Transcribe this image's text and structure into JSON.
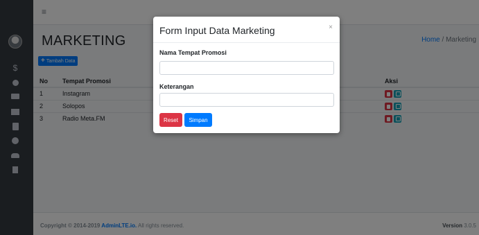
{
  "sidebar": {
    "icons": [
      "avatar",
      "dollar-icon",
      "circle-icon",
      "ticket-icon",
      "building-icon",
      "calculator-icon",
      "info-icon",
      "users-icon",
      "document-icon"
    ],
    "dollar": "$"
  },
  "topbar": {
    "menu_icon": "≡"
  },
  "page": {
    "title": "MARKETING",
    "breadcrumb": {
      "home": "Home",
      "separator": "/",
      "current": "Marketing"
    },
    "add_button": "Tambah Data"
  },
  "table": {
    "headers": {
      "no": "No",
      "name": "Tempat Promosi",
      "action": "Aksi"
    },
    "rows": [
      {
        "no": "1",
        "name": "Instagram"
      },
      {
        "no": "2",
        "name": "Solopos"
      },
      {
        "no": "3",
        "name": "Radio Meta.FM"
      }
    ]
  },
  "footer": {
    "copyright": "Copyright © 2014-2019 ",
    "brand": "AdminLTE.io.",
    "rights": " All rights reserved.",
    "version_label": "Version",
    "version": "3.0.5"
  },
  "modal": {
    "title": "Form Input Data Marketing",
    "close": "×",
    "field1_label": "Nama Tempat Promosi",
    "field1_value": "",
    "field2_label": "Keterangan",
    "field2_value": "",
    "reset_label": "Reset",
    "save_label": "Simpan"
  },
  "colors": {
    "primary": "#007bff",
    "danger": "#dc3545",
    "info": "#17a2b8",
    "sidebar": "#343a40"
  }
}
